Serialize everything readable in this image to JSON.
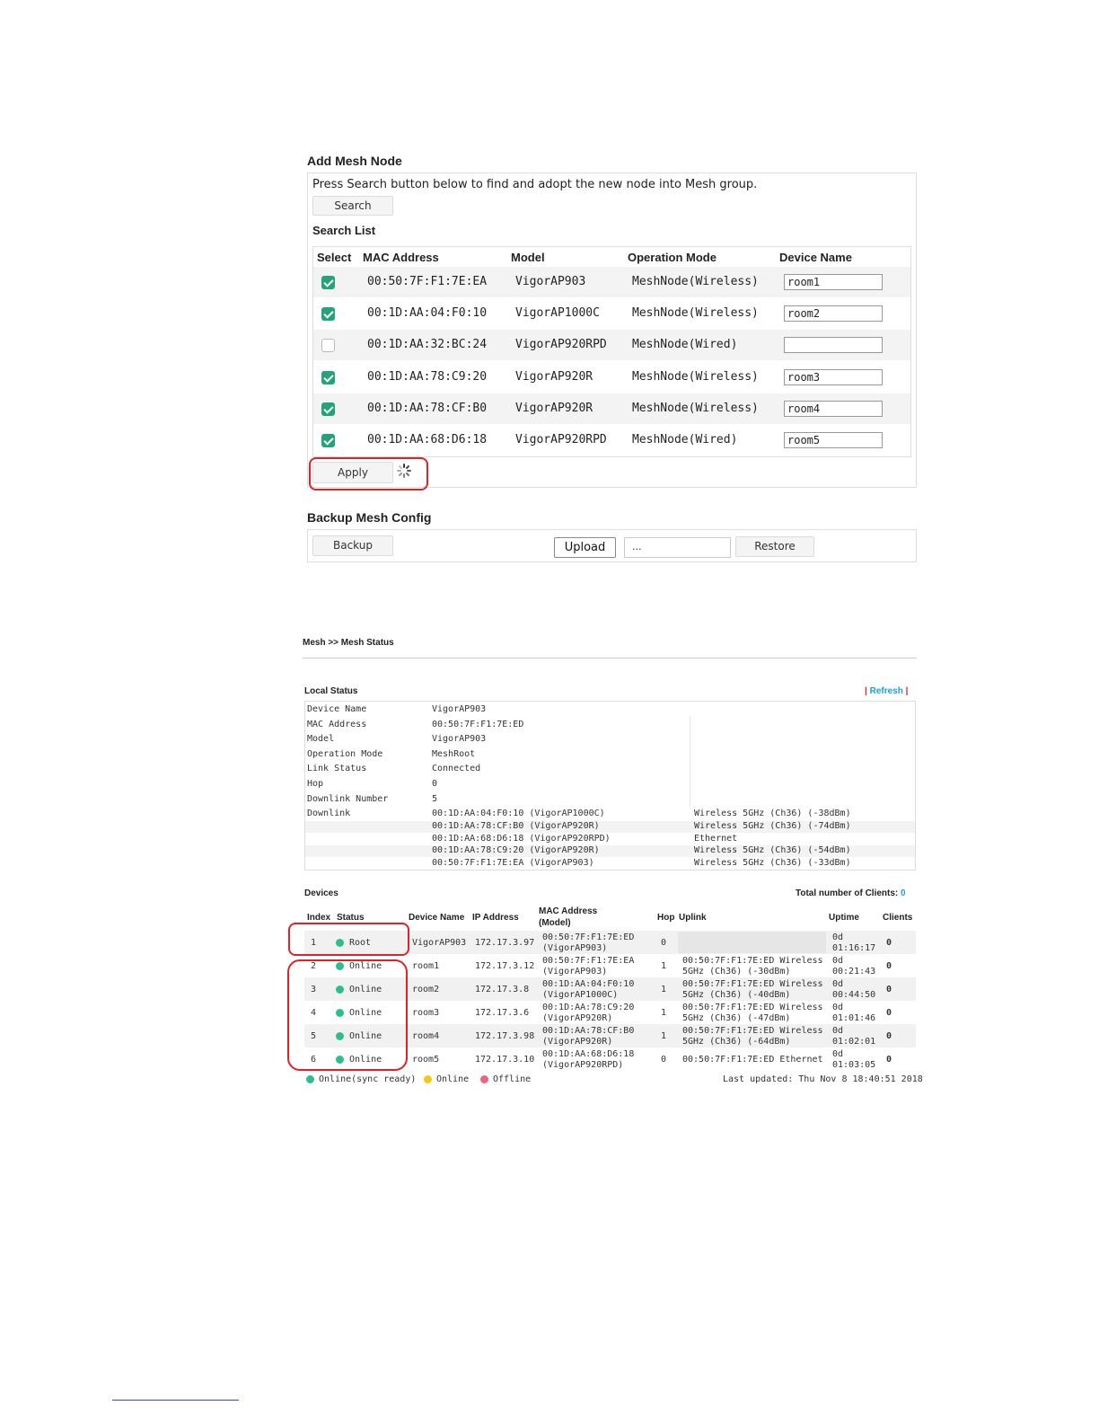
{
  "add_mesh": {
    "title": "Add Mesh Node",
    "instruction": "Press Search button below to find and adopt the new node into Mesh group.",
    "search_label": "Search",
    "list_title": "Search List",
    "columns": [
      "Select",
      "MAC Address",
      "Model",
      "Operation Mode",
      "Device Name"
    ],
    "rows": [
      {
        "checked": true,
        "mac": "00:50:7F:F1:7E:EA",
        "model": "VigorAP903",
        "mode": "MeshNode(Wireless)",
        "name": "room1"
      },
      {
        "checked": true,
        "mac": "00:1D:AA:04:F0:10",
        "model": "VigorAP1000C",
        "mode": "MeshNode(Wireless)",
        "name": "room2"
      },
      {
        "checked": false,
        "mac": "00:1D:AA:32:BC:24",
        "model": "VigorAP920RPD",
        "mode": "MeshNode(Wired)",
        "name": ""
      },
      {
        "checked": true,
        "mac": "00:1D:AA:78:C9:20",
        "model": "VigorAP920R",
        "mode": "MeshNode(Wireless)",
        "name": "room3"
      },
      {
        "checked": true,
        "mac": "00:1D:AA:78:CF:B0",
        "model": "VigorAP920R",
        "mode": "MeshNode(Wireless)",
        "name": "room4"
      },
      {
        "checked": true,
        "mac": "00:1D:AA:68:D6:18",
        "model": "VigorAP920RPD",
        "mode": "MeshNode(Wired)",
        "name": "room5"
      }
    ],
    "apply_label": "Apply"
  },
  "backup": {
    "title": "Backup Mesh Config",
    "backup_label": "Backup",
    "upload_label": "Upload",
    "file_value": "...",
    "restore_label": "Restore"
  },
  "mesh_status": {
    "breadcrumb": "Mesh >> Mesh Status",
    "local_title": "Local Status",
    "refresh_label": "Refresh",
    "local_rows": [
      {
        "label": "Device Name",
        "value": "VigorAP903"
      },
      {
        "label": "MAC Address",
        "value": "00:50:7F:F1:7E:ED"
      },
      {
        "label": "Model",
        "value": "VigorAP903"
      },
      {
        "label": "Operation Mode",
        "value": "MeshRoot"
      },
      {
        "label": "Link Status",
        "value": "Connected"
      },
      {
        "label": "Hop",
        "value": "0"
      },
      {
        "label": "Downlink Number",
        "value": "5"
      }
    ],
    "downlink_label": "Downlink",
    "downlinks": [
      {
        "node": "00:1D:AA:04:F0:10 (VigorAP1000C)",
        "link": "Wireless 5GHz (Ch36) (-38dBm)"
      },
      {
        "node": "00:1D:AA:78:CF:B0 (VigorAP920R)",
        "link": "Wireless 5GHz (Ch36) (-74dBm)"
      },
      {
        "node": "00:1D:AA:68:D6:18 (VigorAP920RPD)",
        "link": "Ethernet"
      },
      {
        "node": "00:1D:AA:78:C9:20 (VigorAP920R)",
        "link": "Wireless 5GHz (Ch36) (-54dBm)"
      },
      {
        "node": "00:50:7F:F1:7E:EA (VigorAP903)",
        "link": "Wireless 5GHz (Ch36) (-33dBm)"
      }
    ],
    "devices_title": "Devices",
    "total_clients_label": "Total number of Clients:",
    "total_clients": "0",
    "dev_columns": {
      "index": "Index",
      "status": "Status",
      "name": "Device Name",
      "ip": "IP Address",
      "mac_1": "MAC Address",
      "mac_2": "(Model)",
      "hop": "Hop",
      "uplink": "Uplink",
      "uptime": "Uptime",
      "clients": "Clients"
    },
    "devices": [
      {
        "index": "1",
        "status": "Root",
        "name": "VigorAP903",
        "ip": "172.17.3.97",
        "mac": "00:50:7F:F1:7E:ED",
        "model": "(VigorAP903)",
        "hop": "0",
        "uplink_1": "",
        "uplink_2": "",
        "uptime_1": "0d",
        "uptime_2": "01:16:17",
        "clients": "0"
      },
      {
        "index": "2",
        "status": "Online",
        "name": "room1",
        "ip": "172.17.3.12",
        "mac": "00:50:7F:F1:7E:EA",
        "model": "(VigorAP903)",
        "hop": "1",
        "uplink_1": "00:50:7F:F1:7E:ED Wireless",
        "uplink_2": "5GHz (Ch36) (-30dBm)",
        "uptime_1": "0d",
        "uptime_2": "00:21:43",
        "clients": "0"
      },
      {
        "index": "3",
        "status": "Online",
        "name": "room2",
        "ip": "172.17.3.8",
        "mac": "00:1D:AA:04:F0:10",
        "model": "(VigorAP1000C)",
        "hop": "1",
        "uplink_1": "00:50:7F:F1:7E:ED Wireless",
        "uplink_2": "5GHz (Ch36) (-40dBm)",
        "uptime_1": "0d",
        "uptime_2": "00:44:50",
        "clients": "0"
      },
      {
        "index": "4",
        "status": "Online",
        "name": "room3",
        "ip": "172.17.3.6",
        "mac": "00:1D:AA:78:C9:20",
        "model": "(VigorAP920R)",
        "hop": "1",
        "uplink_1": "00:50:7F:F1:7E:ED Wireless",
        "uplink_2": "5GHz (Ch36) (-47dBm)",
        "uptime_1": "0d",
        "uptime_2": "01:01:46",
        "clients": "0"
      },
      {
        "index": "5",
        "status": "Online",
        "name": "room4",
        "ip": "172.17.3.98",
        "mac": "00:1D:AA:78:CF:B0",
        "model": "(VigorAP920R)",
        "hop": "1",
        "uplink_1": "00:50:7F:F1:7E:ED Wireless",
        "uplink_2": "5GHz (Ch36) (-64dBm)",
        "uptime_1": "0d",
        "uptime_2": "01:02:01",
        "clients": "0"
      },
      {
        "index": "6",
        "status": "Online",
        "name": "room5",
        "ip": "172.17.3.10",
        "mac": "00:1D:AA:68:D6:18",
        "model": "(VigorAP920RPD)",
        "hop": "0",
        "uplink_1": "00:50:7F:F1:7E:ED Ethernet",
        "uplink_2": "",
        "uptime_1": "0d",
        "uptime_2": "01:03:05",
        "clients": "0"
      }
    ],
    "legend": {
      "sync_ready": "Online(sync ready)",
      "online": "Online",
      "offline": "Offline"
    },
    "last_updated": "Last updated:  Thu Nov 8 18:40:51 2018"
  },
  "colors": {
    "green": "#2bbf8e",
    "yellow": "#f5c518",
    "red": "#f06478",
    "accent": "#1a9fd8",
    "highlight": "#e0212a"
  }
}
